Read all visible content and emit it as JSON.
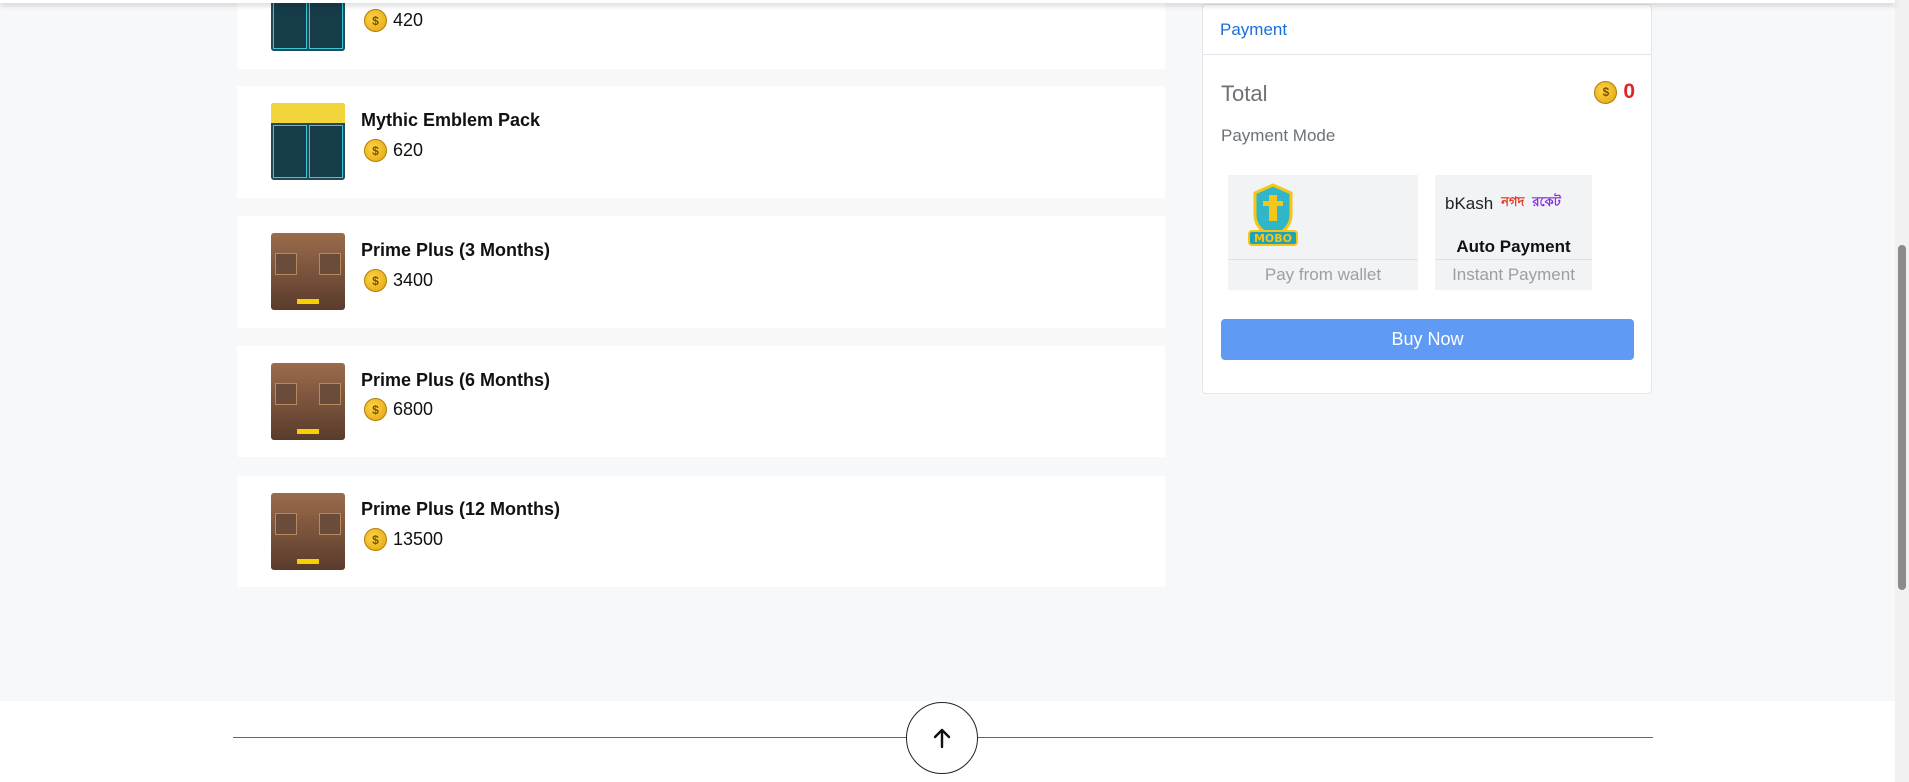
{
  "products": [
    {
      "name": "",
      "price": "420",
      "thumb": "emblem"
    },
    {
      "name": "Mythic Emblem Pack",
      "price": "620",
      "thumb": "emblem"
    },
    {
      "name": "Prime Plus (3 Months)",
      "price": "3400",
      "thumb": "prime"
    },
    {
      "name": "Prime Plus (6 Months)",
      "price": "6800",
      "thumb": "prime"
    },
    {
      "name": "Prime Plus (12 Months)",
      "price": "13500",
      "thumb": "prime"
    }
  ],
  "payment": {
    "header": "Payment",
    "total_label": "Total",
    "total_value": "0",
    "mode_label": "Payment Mode",
    "wallet": {
      "logo_text": "MOBO",
      "caption": "Pay from wallet"
    },
    "auto": {
      "brands": [
        "bKash",
        "নগদ",
        "রকেট"
      ],
      "title": "Auto Payment",
      "caption": "Instant Payment"
    },
    "buy_label": "Buy Now"
  },
  "colors": {
    "accent": "#1a6fd6",
    "buy_button": "#5f9bf5",
    "total_value": "#dc2626",
    "coin": "#f2b620"
  },
  "icons": {
    "scroll_top": "arrow-up-icon",
    "currency": "coin-icon"
  }
}
